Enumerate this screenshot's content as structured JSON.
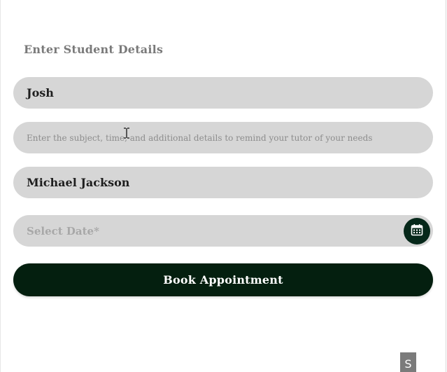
{
  "form": {
    "heading": "Enter Student Details",
    "student_name_value": "Josh",
    "details_placeholder": "Enter the subject, time, and additional details to remind your tutor of your needs",
    "tutor_name_value": "Michael Jackson",
    "date_placeholder": "Select Date*",
    "book_button_label": "Book Appointment"
  },
  "icons": {
    "calendar": "calendar-icon",
    "cursor": "text-cursor-icon"
  },
  "corner_tag": "S",
  "colors": {
    "field_bg": "#d6d6d6",
    "button_bg": "#041f0f",
    "heading_text": "#7a7a7a"
  }
}
